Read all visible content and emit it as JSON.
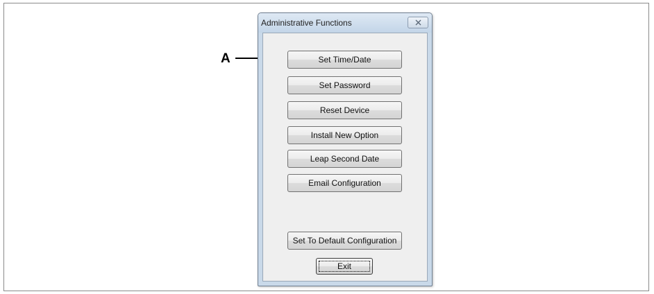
{
  "callout": {
    "label": "A"
  },
  "dialog": {
    "title": "Administrative Functions",
    "close_icon": "close-x-icon",
    "buttons": [
      {
        "label": "Set Time/Date"
      },
      {
        "label": "Set Password"
      },
      {
        "label": "Reset Device"
      },
      {
        "label": "Install New Option"
      },
      {
        "label": "Leap Second Date"
      },
      {
        "label": "Email Configuration"
      },
      {
        "label": "Set To Default Configuration"
      }
    ],
    "exit_label": "Exit"
  },
  "colors": {
    "titlebar": "#c9d9e9",
    "client_background": "#efefef"
  }
}
